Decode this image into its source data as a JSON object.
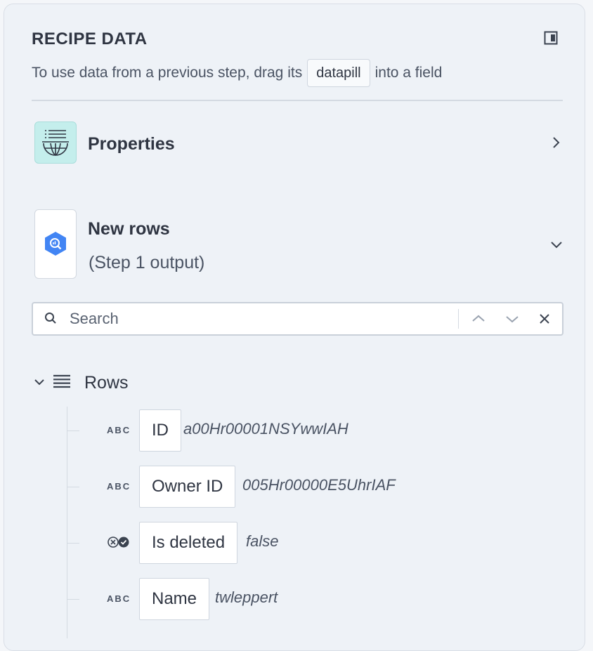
{
  "header": {
    "title": "RECIPE DATA",
    "hint_prefix": "To use data from a previous step, drag its",
    "hint_pill": "datapill",
    "hint_suffix": "into a field"
  },
  "properties": {
    "label": "Properties"
  },
  "step": {
    "title": "New rows",
    "subtitle": "(Step 1 output)"
  },
  "search": {
    "placeholder": "Search",
    "value": ""
  },
  "tree": {
    "label": "Rows",
    "fields": [
      {
        "type": "ABC",
        "name": "ID",
        "value": "a00Hr00001NSYwwIAH"
      },
      {
        "type": "ABC",
        "name": "Owner ID",
        "value": "005Hr00000E5UhrIAF"
      },
      {
        "type": "boolean-icon",
        "name": "Is deleted",
        "value": "false"
      },
      {
        "type": "ABC",
        "name": "Name",
        "value": "twleppert"
      }
    ]
  },
  "colors": {
    "panel_bg": "#eef2f7",
    "properties_icon_bg": "#c4eeec",
    "bigquery_blue": "#4285f4",
    "text": "#2f3542"
  }
}
